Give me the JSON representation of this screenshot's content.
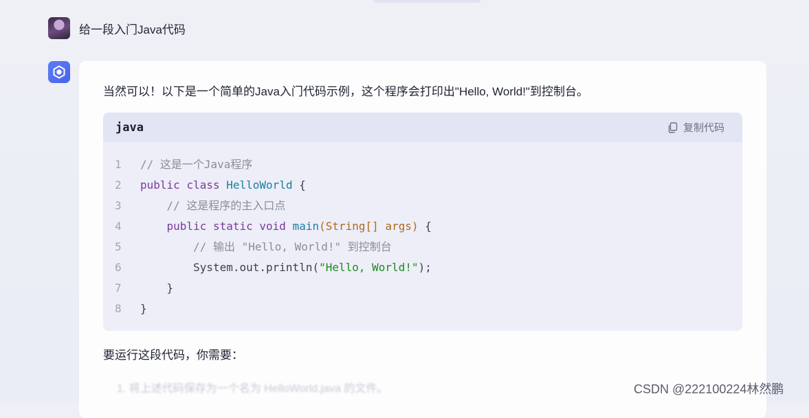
{
  "user_message": "给一段入门Java代码",
  "assistant": {
    "intro": "当然可以！以下是一个简单的Java入门代码示例，这个程序会打印出\"Hello, World!\"到控制台。",
    "code_block": {
      "language": "java",
      "copy_label": "复制代码",
      "line_numbers": [
        "1",
        "2",
        "3",
        "4",
        "5",
        "6",
        "7",
        "8"
      ],
      "lines": [
        "// 这是一个Java程序",
        "public class HelloWorld {",
        "    // 这是程序的主入口点",
        "    public static void main(String[] args) {",
        "        // 输出 \"Hello, World!\" 到控制台",
        "        System.out.println(\"Hello, World!\");",
        "    }",
        "}"
      ]
    },
    "after_text": "要运行这段代码，你需要：",
    "faded_text": "1. 将上述代码保存为一个名为 HelloWorld.java 的文件。"
  },
  "watermark": "CSDN @222100224林然鹏",
  "colors": {
    "accent": "#5b7df7",
    "code_bg": "#edeef8",
    "code_head": "#e2e5f3"
  }
}
